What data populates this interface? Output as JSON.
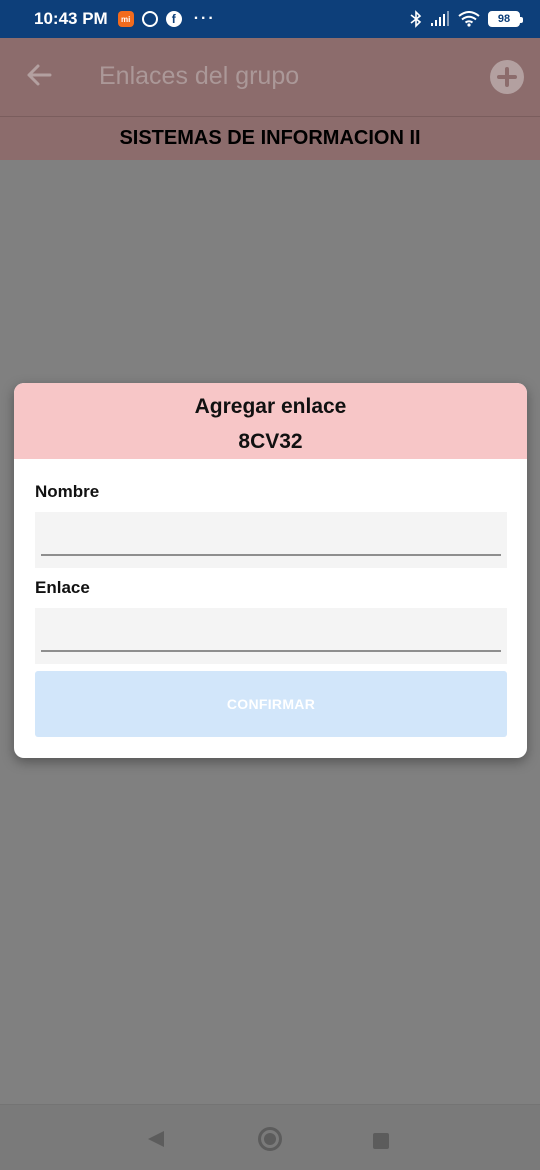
{
  "status_bar": {
    "time": "10:43 PM",
    "battery": "98",
    "icons": [
      "mi-store-icon",
      "ring-icon",
      "facebook-icon",
      "more-dots-icon",
      "bluetooth-icon",
      "signal-icon",
      "wifi-icon",
      "battery-icon"
    ]
  },
  "app_bar": {
    "title": "Enlaces del grupo",
    "back_icon": "arrow-left-icon",
    "add_icon": "plus-circle-icon"
  },
  "subheader": {
    "text": "SISTEMAS DE INFORMACION II"
  },
  "dialog": {
    "title": "Agregar enlace",
    "code": "8CV32",
    "header_color": "#f7c6c7",
    "fields": [
      {
        "label": "Nombre",
        "value": ""
      },
      {
        "label": "Enlace",
        "value": ""
      }
    ],
    "confirm_label": "CONFIRMAR",
    "confirm_color": "#d2e6fa"
  },
  "nav_bar": {
    "icons": [
      "nav-back-icon",
      "nav-home-icon",
      "nav-recents-icon"
    ]
  }
}
